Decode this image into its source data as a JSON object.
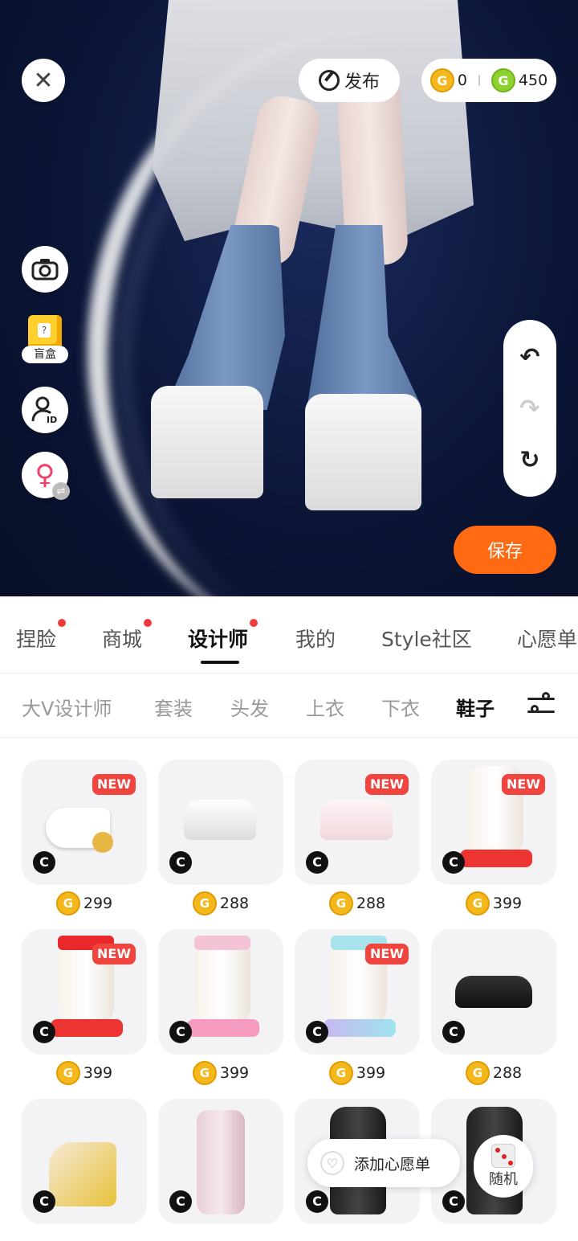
{
  "top_bar": {
    "publish_label": "发布",
    "coin_gold_value": "0",
    "coin_green_value": "450"
  },
  "side_tools": {
    "blind_box_label": "盲盒"
  },
  "save_label": "保存",
  "main_tabs": [
    "捏脸",
    "商城",
    "设计师",
    "我的",
    "Style社区",
    "心愿单"
  ],
  "main_tab_active": "设计师",
  "sub_tabs": [
    "大V设计师",
    "套装",
    "头发",
    "上衣",
    "下衣",
    "鞋子"
  ],
  "sub_tab_active": "鞋子",
  "items": [
    {
      "price": "299",
      "new_label": "NEW"
    },
    {
      "price": "288",
      "new_label": ""
    },
    {
      "price": "288",
      "new_label": "NEW"
    },
    {
      "price": "399",
      "new_label": "NEW"
    },
    {
      "price": "399",
      "new_label": "NEW"
    },
    {
      "price": "399",
      "new_label": ""
    },
    {
      "price": "399",
      "new_label": "NEW"
    },
    {
      "price": "288",
      "new_label": ""
    }
  ],
  "wishlist_add_label": "添加心愿单",
  "random_label": "随机",
  "colors": {
    "accent_orange": "#ff6a13",
    "badge_red": "#f0443f",
    "coin_gold": "#f4b81d",
    "coin_green": "#8dd22f",
    "scene_bg": "#0b1637"
  }
}
